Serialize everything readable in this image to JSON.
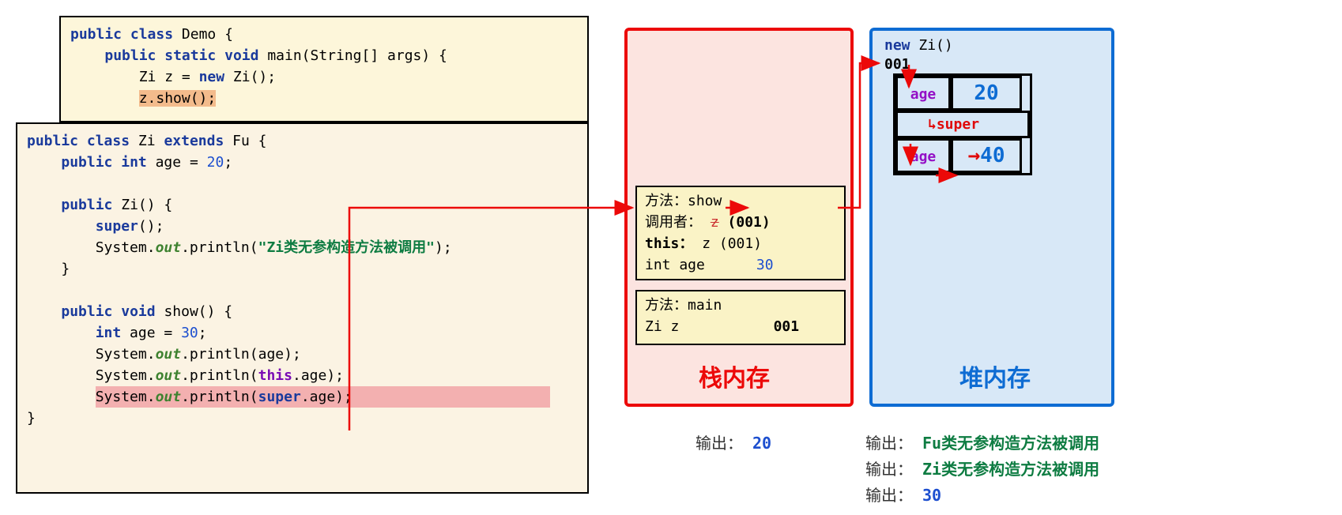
{
  "demo": {
    "line1_kw1": "public",
    "line1_kw2": "class",
    "line1_name": "Demo {",
    "line2_kw1": "public",
    "line2_kw2": "static",
    "line2_kw3": "void",
    "line2_sig": "main(String[] args) {",
    "line3_pre": "Zi z = ",
    "line3_kw": "new",
    "line3_post": " Zi();",
    "line4": "z.show();"
  },
  "zi": {
    "line1_kw1": "public",
    "line1_kw2": "class",
    "line1_name": "Zi",
    "line1_kw3": "extends",
    "line1_super": "Fu {",
    "line2_kw1": "public",
    "line2_kw2": "int",
    "line2_name": "age = ",
    "line2_val": "20",
    "line2_end": ";",
    "ctor_kw": "public",
    "ctor_sig": "Zi() {",
    "ctor_super_kw": "super",
    "ctor_super_call": "();",
    "ctor_print_pre": "System.",
    "ctor_print_out": "out",
    "ctor_print_mid": ".println(",
    "ctor_print_str": "\"Zi类无参构造方法被调用\"",
    "ctor_print_end": ");",
    "ctor_close": "}",
    "show_kw1": "public",
    "show_kw2": "void",
    "show_sig": "show() {",
    "show_l1_kw": "int",
    "show_l1_rest": " age = ",
    "show_l1_val": "30",
    "show_l1_end": ";",
    "show_l2_pre": "System.",
    "show_l2_out": "out",
    "show_l2_end": ".println(age);",
    "show_l3_pre": "System.",
    "show_l3_out": "out",
    "show_l3_mid": ".println(",
    "show_l3_kw": "this",
    "show_l3_end": ".age);",
    "show_l4_pre": "System.",
    "show_l4_out": "out",
    "show_l4_mid": ".println(",
    "show_l4_kw": "super",
    "show_l4_end": ".age);",
    "close": "}"
  },
  "stack": {
    "label": "栈内存",
    "show_method": "方法：show",
    "show_caller_lbl": "调用者：",
    "show_caller_var": "z",
    "show_caller_addr": "(001)",
    "show_this_lbl": "this：",
    "show_this_val": "z (001)",
    "show_age_lbl": "int age",
    "show_age_val": "30",
    "main_method": "方法：main",
    "main_var": "Zi z",
    "main_addr": "001"
  },
  "heap": {
    "label": "堆内存",
    "new_kw": "new",
    "new_type": "Zi()",
    "addr": "001",
    "row1_key": "age",
    "row1_val": "20",
    "row_super": "super",
    "row2_key": "age",
    "row2_val": "40"
  },
  "output": {
    "lbl": "输出：",
    "left_val": "20",
    "r1": "Fu类无参构造方法被调用",
    "r2": "Zi类无参构造方法被调用",
    "r3": "30"
  }
}
